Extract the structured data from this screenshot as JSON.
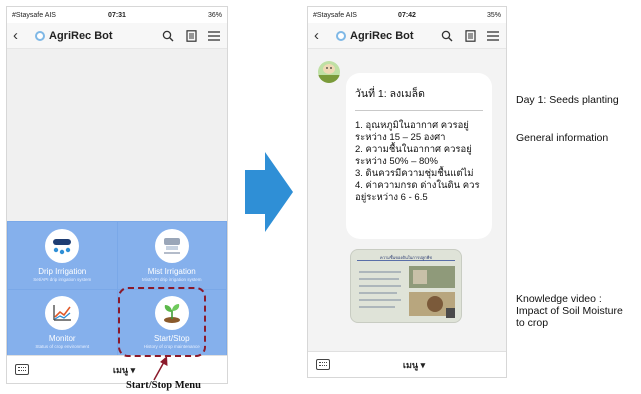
{
  "left_phone": {
    "status": {
      "carrier": "#Staysafe AIS",
      "time": "07:31",
      "battery": "36%"
    },
    "header": {
      "title": "AgriRec Bot"
    },
    "rich_menu": [
      {
        "label": "Drip Irrigation",
        "sub": "Set/API drip irrigation system",
        "icon": "drip-irrigation-icon"
      },
      {
        "label": "Mist Irrigation",
        "sub": "Mist/API drip irrigation system",
        "icon": "mist-irrigation-icon"
      },
      {
        "label": "Monitor",
        "sub": "Status of crop environment",
        "icon": "monitor-chart-icon"
      },
      {
        "label": "Start/Stop",
        "sub": "History of crop maintenance",
        "icon": "sprout-icon"
      }
    ],
    "bottom_bar": {
      "menu_label": "เมนู ▾"
    }
  },
  "caption": "Start/Stop Menu",
  "right_phone": {
    "status": {
      "carrier": "#Staysafe AIS",
      "time": "07:42",
      "battery": "35%"
    },
    "header": {
      "title": "AgriRec Bot"
    },
    "message": {
      "title": "วันที่ 1: ลงเมล็ด",
      "lines": [
        "1. อุณหภูมิในอากาศ ควรอยู่",
        "ระหว่าง 15 – 25 องศา",
        "2. ความชื้นในอากาศ ควรอยู่",
        "ระหว่าง 50% – 80%",
        "3. ดินควรมีความชุ่มชื้นแต่ไม่",
        "4. ค่าความกรด ด่างในดิน ควร",
        "อยู่ระหว่าง 6 - 6.5"
      ]
    },
    "video": {
      "title": "ความชื้นของดินในการปลูกพืช"
    },
    "bottom_bar": {
      "menu_label": "เมนู ▾"
    }
  },
  "annotations": {
    "day1": "Day 1: Seeds planting",
    "general": "General information",
    "knowledge_1": "Knowledge video :",
    "knowledge_2": "Impact of Soil Moisture",
    "knowledge_3": "to crop"
  },
  "colors": {
    "menu_blue": "#85b0ec",
    "arrow_blue": "#2f8fd6",
    "highlight": "#8b1a2b"
  }
}
